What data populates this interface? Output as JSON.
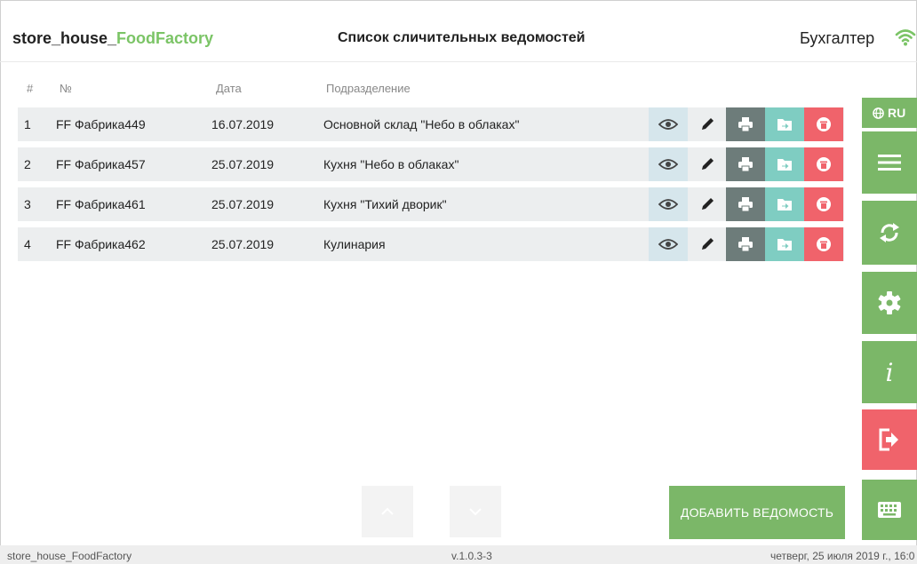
{
  "header": {
    "brand_main": "store_house_",
    "brand_accent": "FoodFactory",
    "title": "Список сличительных ведомостей",
    "role": "Бухгалтер"
  },
  "table": {
    "columns": [
      "#",
      "№",
      "Дата",
      "Подразделение"
    ],
    "rows": [
      {
        "idx": "1",
        "number": "FF Фабрика449",
        "date": "16.07.2019",
        "division": "Основной склад \"Небо в облаках\""
      },
      {
        "idx": "2",
        "number": "FF Фабрика457",
        "date": "25.07.2019",
        "division": "Кухня \"Небо в облаках\""
      },
      {
        "idx": "3",
        "number": "FF Фабрика461",
        "date": "25.07.2019",
        "division": "Кухня \"Тихий дворик\""
      },
      {
        "idx": "4",
        "number": "FF Фабрика462",
        "date": "25.07.2019",
        "division": "Кулинария"
      }
    ]
  },
  "sidebar": {
    "lang_label": "RU",
    "icons": [
      "globe-icon",
      "menu-icon",
      "refresh-icon",
      "gear-icon",
      "info-icon",
      "logout-icon",
      "keyboard-icon"
    ]
  },
  "actions": {
    "add_label": "ДОБАВИТЬ ВЕДОМОСТЬ"
  },
  "footer": {
    "app_name": "store_house_FoodFactory",
    "version": "v.1.0.3-3",
    "datetime": "четверг, 25 июля 2019 г., 16:0"
  },
  "colors": {
    "accent_green": "#7bb768",
    "brand_green": "#7bc466",
    "danger_red": "#f0636b",
    "teal": "#7fcdc2",
    "print_gray": "#6d7c7a",
    "view_blue": "#d6e6ec"
  }
}
